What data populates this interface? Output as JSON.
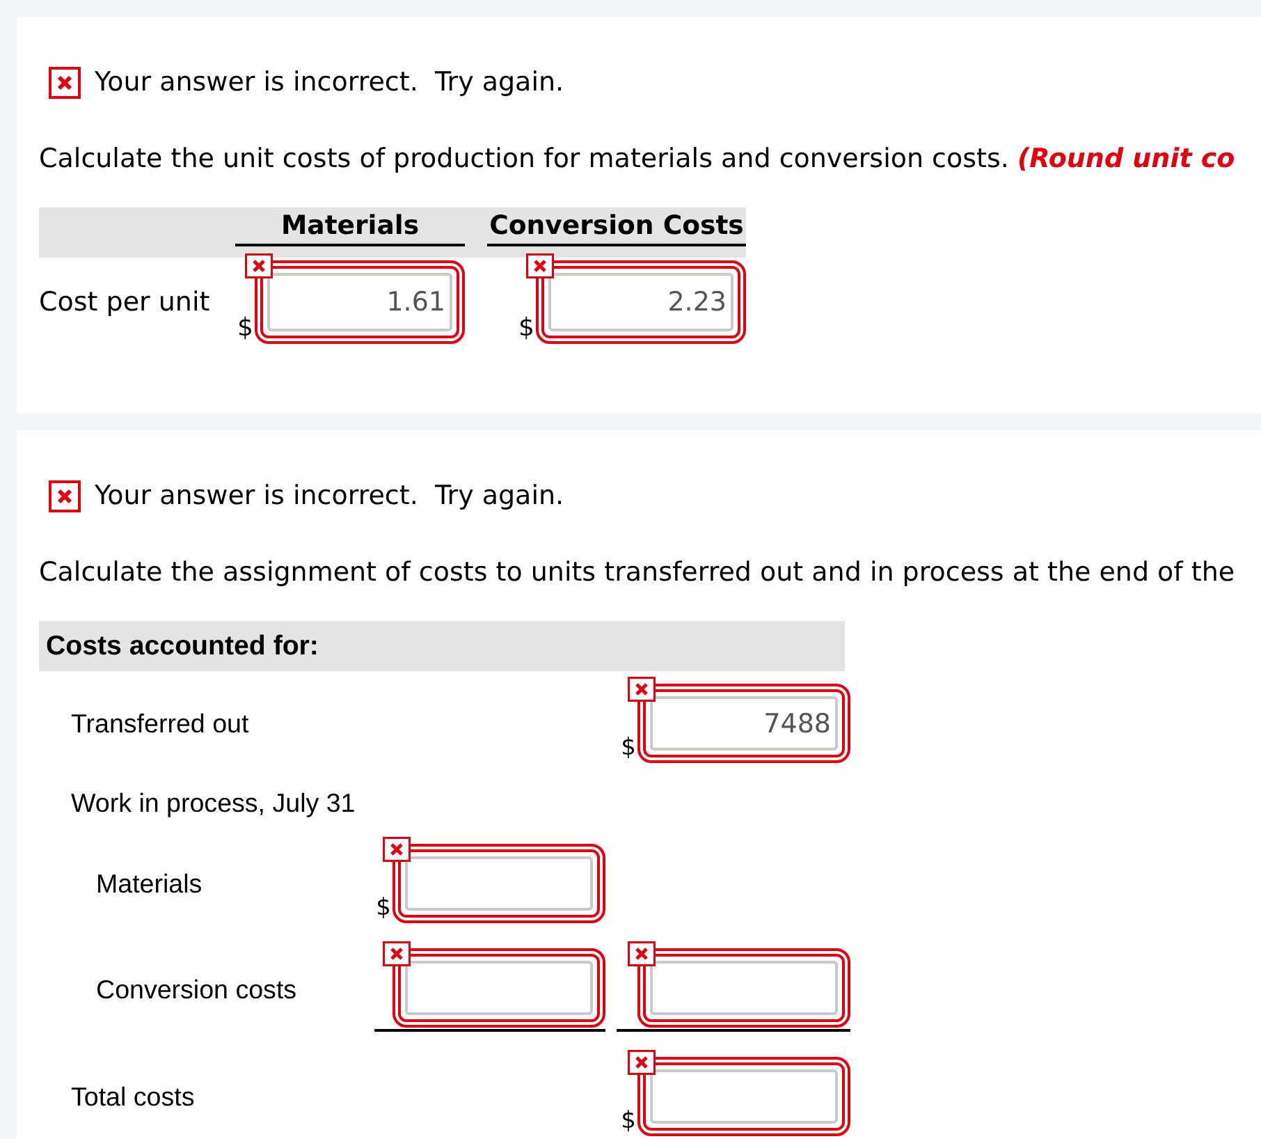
{
  "sections": [
    {
      "result": {
        "correct": false,
        "message": "Your answer is incorrect.  Try again."
      },
      "instruction": {
        "text": "Calculate the unit costs of production for materials and conversion costs.",
        "note": "(Round unit co"
      },
      "table": {
        "columns": [
          "Materials",
          "Conversion Costs"
        ],
        "rows": [
          {
            "label": "Cost per unit",
            "cells": [
              {
                "currency": "$",
                "value": "1.61",
                "incorrect": true
              },
              {
                "currency": "$",
                "value": "2.23",
                "incorrect": true
              }
            ]
          }
        ]
      }
    },
    {
      "result": {
        "correct": false,
        "message": "Your answer is incorrect.  Try again."
      },
      "instruction": {
        "text": "Calculate the assignment of costs to units transferred out and in process at the end of the"
      },
      "table": {
        "heading": "Costs accounted for:",
        "rows": [
          {
            "label": "Transferred out",
            "total": {
              "currency": "$",
              "value": "7488",
              "incorrect": true
            }
          },
          {
            "label": "Work in process, July 31",
            "children": [
              {
                "label": "Materials",
                "amount": {
                  "currency": "$",
                  "incorrect": true
                }
              },
              {
                "label": "Conversion costs",
                "amount": {
                  "incorrect": true,
                  "underlined": true
                },
                "total": {
                  "incorrect": true,
                  "underlined": true
                }
              }
            ]
          },
          {
            "label": "Total costs",
            "total": {
              "currency": "$",
              "incorrect": true
            }
          }
        ]
      }
    }
  ]
}
